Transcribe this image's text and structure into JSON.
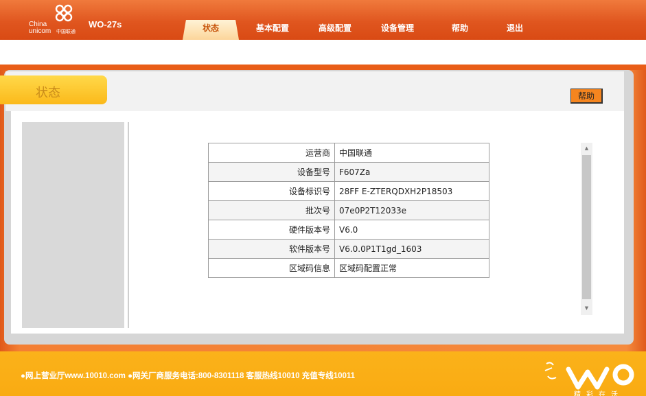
{
  "brand": {
    "china": "China",
    "unicom": "unicom",
    "cn": "中国联通",
    "model": "WO-27s"
  },
  "nav": [
    {
      "label": "状态",
      "active": true
    },
    {
      "label": "基本配置",
      "active": false
    },
    {
      "label": "高级配置",
      "active": false
    },
    {
      "label": "设备管理",
      "active": false
    },
    {
      "label": "帮助",
      "active": false
    },
    {
      "label": "退出",
      "active": false
    }
  ],
  "page": {
    "title": "状态",
    "help_button": "帮助"
  },
  "status_table": [
    {
      "key": "运营商",
      "value": "中国联通"
    },
    {
      "key": "设备型号",
      "value": "F607Za"
    },
    {
      "key": "设备标识号",
      "value": "28FF E-ZTERQDXH2P18503"
    },
    {
      "key": "批次号",
      "value": "07e0P2T12033e"
    },
    {
      "key": "硬件版本号",
      "value": "V6.0"
    },
    {
      "key": "软件版本号",
      "value": "V6.0.0P1T1gd_1603"
    },
    {
      "key": "区域码信息",
      "value": "区域码配置正常"
    }
  ],
  "footer": {
    "text": "●网上营业厅www.10010.com ●网关厂商服务电话:800-8301118 客服热线10010 充值专线10011",
    "slogan": "精彩在沃"
  },
  "colors": {
    "header": "#e0561f",
    "accent": "#f5851f",
    "footer": "#fbb21a",
    "title_tab": "#ffd94a"
  }
}
